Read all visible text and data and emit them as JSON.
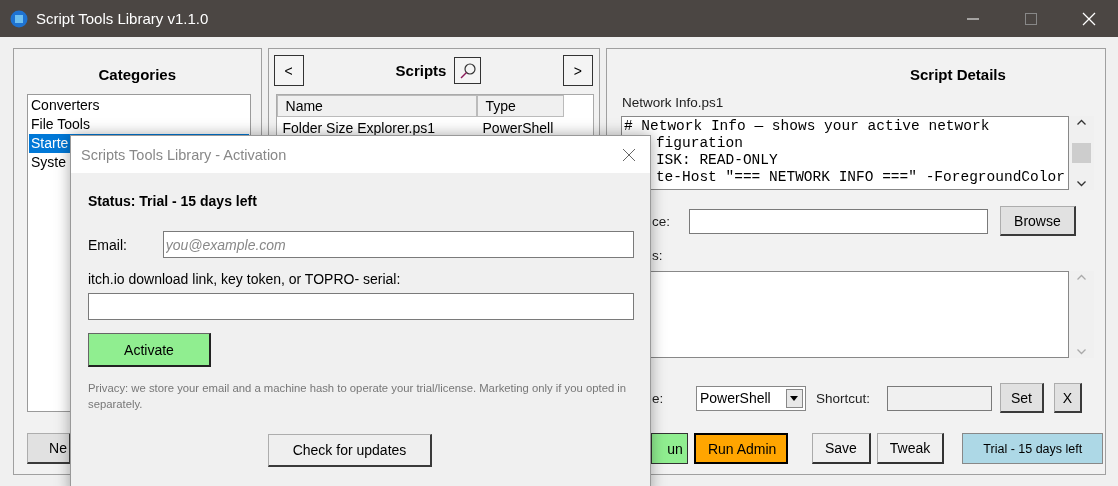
{
  "window": {
    "title": "Script Tools Library v1.1.0"
  },
  "categories": {
    "title": "Categories",
    "items": [
      {
        "label": "Converters",
        "selected": false
      },
      {
        "label": "File Tools",
        "selected": false
      },
      {
        "label": "Starte",
        "selected": true
      },
      {
        "label": "Syste",
        "selected": false
      }
    ],
    "new_button": "Ne"
  },
  "scripts": {
    "title": "Scripts",
    "prev": "<",
    "next": ">",
    "columns": [
      "Name",
      "Type"
    ],
    "rows": [
      {
        "name": "Folder Size Explorer.ps1",
        "type": "PowerShell"
      }
    ]
  },
  "details": {
    "title": "Script Details",
    "file_name": "Network Info.ps1",
    "code_lines": [
      {
        "text": "# Network Info — shows your active network",
        "partial": false
      },
      {
        "text": "figuration",
        "partial": true
      },
      {
        "text": "ISK: READ-ONLY",
        "partial": true
      },
      {
        "text": "te-Host \"=== NETWORK INFO ===\" -ForegroundColor",
        "partial": true
      }
    ],
    "source_label": "ce:",
    "browse": "Browse",
    "notes_label": "s:",
    "type_label": "e:",
    "type_value": "PowerShell",
    "shortcut": {
      "label": "Shortcut:",
      "disabled": true
    },
    "set": "Set",
    "clear": "X",
    "buttons": [
      {
        "label": "un",
        "kind": "run"
      },
      {
        "label": "Run Admin",
        "kind": "admin"
      },
      {
        "label": "Save",
        "kind": "plain"
      },
      {
        "label": "Tweak",
        "kind": "plain"
      }
    ],
    "trial_badge": "Trial - 15 days left"
  },
  "dialog": {
    "title": "Scripts Tools Library - Activation",
    "status": "Status: Trial - 15 days left",
    "email": {
      "label": "Email:",
      "placeholder": "you@example.com"
    },
    "key_label": "itch.io download link, key token, or TOPRO- serial:",
    "activate": "Activate",
    "privacy": "Privacy: we store your email and a machine hash to operate your trial/license. Marketing only if you opted in separately.",
    "check_updates": "Check for updates"
  }
}
